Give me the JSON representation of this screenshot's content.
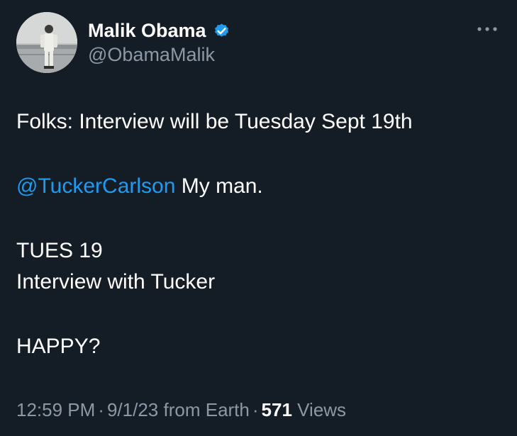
{
  "author": {
    "display_name": "Malik Obama",
    "handle": "@ObamaMalik",
    "verified": true,
    "accent_color": "#1d9bf0"
  },
  "icons": {
    "verified": "verified-badge-icon",
    "more": "more-options-icon"
  },
  "tweet": {
    "line1": "Folks: Interview will be Tuesday Sept 19th",
    "mention": "@TuckerCarlson",
    "mention_suffix": " My man.",
    "line3": "TUES 19",
    "line4": "Interview with Tucker",
    "line5": "HAPPY?"
  },
  "meta": {
    "time": "12:59 PM",
    "separator": "·",
    "date": "9/1/23",
    "source": "from Earth",
    "views_count": "571",
    "views_label": "Views"
  },
  "colors": {
    "background": "#141d26",
    "text": "#ffffff",
    "secondary": "#8b98a5",
    "link": "#1d9bf0"
  }
}
